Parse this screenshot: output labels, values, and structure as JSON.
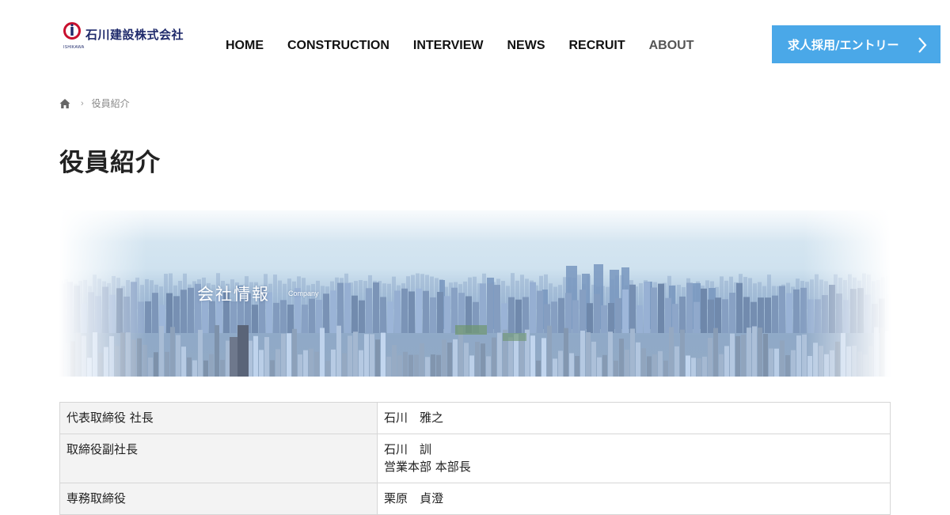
{
  "header": {
    "logo_text": "石川建設株式会社",
    "logo_sub": "ISHIKAWA",
    "nav": [
      {
        "label": "HOME",
        "active": false
      },
      {
        "label": "CONSTRUCTION",
        "active": false
      },
      {
        "label": "INTERVIEW",
        "active": false
      },
      {
        "label": "NEWS",
        "active": false
      },
      {
        "label": "RECRUIT",
        "active": false
      },
      {
        "label": "ABOUT",
        "active": true
      }
    ],
    "entry_button": {
      "label": "求人採用/エントリー",
      "icon": "chevron-right-icon"
    }
  },
  "breadcrumb": {
    "home_icon": "home-icon",
    "separator": "›",
    "current": "役員紹介"
  },
  "page_title": "役員紹介",
  "hero": {
    "title": "会社情報",
    "subtitle": "Company"
  },
  "officers": [
    {
      "role": "代表取締役 社長",
      "name": [
        "石川　雅之"
      ]
    },
    {
      "role": "取締役副社長",
      "name": [
        "石川　訓",
        "営業本部 本部長"
      ]
    },
    {
      "role": "専務取締役",
      "name": [
        "栗原　貞澄"
      ]
    }
  ],
  "colors": {
    "accent": "#4aa8e8",
    "logo_navy": "#1f2a6b",
    "logo_red": "#c8102e",
    "role_bg": "#f3f3f3",
    "border": "#d6d6d6"
  }
}
